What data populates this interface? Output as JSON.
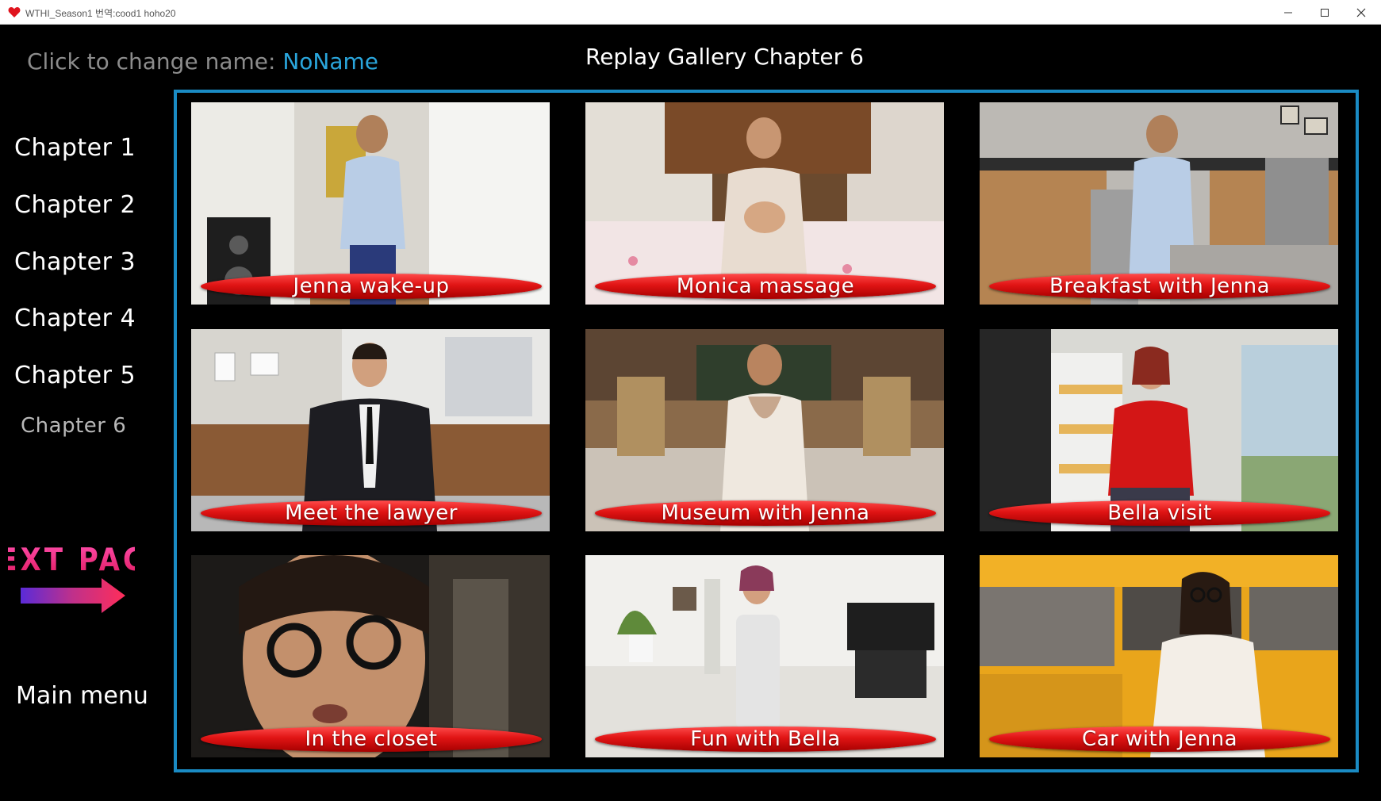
{
  "window": {
    "title": "WTHI_Season1  번역:cood1 hoho20",
    "min_icon": "minimize-icon",
    "max_icon": "maximize-icon",
    "close_icon": "close-icon",
    "app_icon": "heart-icon",
    "app_icon_color": "#e0141e"
  },
  "header": {
    "name_prompt": "Click to change name:",
    "name_value": "NoName",
    "gallery_title": "Replay Gallery Chapter 6"
  },
  "sidebar": {
    "chapters": [
      {
        "label": "Chapter 1"
      },
      {
        "label": "Chapter 2"
      },
      {
        "label": "Chapter 3"
      },
      {
        "label": "Chapter 4"
      },
      {
        "label": "Chapter 5"
      },
      {
        "label": "Chapter 6",
        "active": true
      }
    ],
    "next_page": "NEXT PAGE",
    "main_menu": "Main menu"
  },
  "gallery": {
    "frame_color": "#1a8bc4",
    "items": [
      {
        "label": "Jenna wake-up"
      },
      {
        "label": "Monica massage"
      },
      {
        "label": "Breakfast with Jenna"
      },
      {
        "label": "Meet the lawyer"
      },
      {
        "label": "Museum with Jenna"
      },
      {
        "label": "Bella visit"
      },
      {
        "label": "In the closet"
      },
      {
        "label": "Fun with Bella"
      },
      {
        "label": "Car with Jenna"
      }
    ]
  },
  "colors": {
    "name_value": "#2aa6dc",
    "label_pill": "#e01414",
    "next_page_text": "#ff2e8e"
  }
}
